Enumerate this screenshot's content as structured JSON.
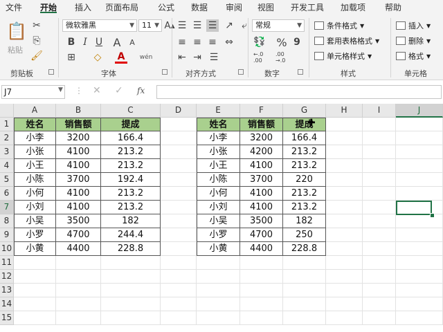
{
  "tabs": [
    "文件",
    "开始",
    "插入",
    "页面布局",
    "公式",
    "数据",
    "审阅",
    "视图",
    "开发工具",
    "加载项",
    "帮助"
  ],
  "active_tab": "开始",
  "ribbon": {
    "clipboard": {
      "paste": "粘贴",
      "label": "剪贴板"
    },
    "font": {
      "name": "微软雅黑",
      "size": "11",
      "label": "字体",
      "grow_glyph": "A",
      "shrink_glyph": "A",
      "bold": "B",
      "italic": "I",
      "underline": "U",
      "wen": "wén",
      "font_color_glyph": "A"
    },
    "alignment": {
      "label": "对齐方式"
    },
    "number": {
      "format": "常规",
      "label": "数字",
      "percent": "%",
      "comma": "9",
      "inc_decimal": "←.0 .00",
      "dec_decimal": ".00 →.0"
    },
    "styles": {
      "conditional": "条件格式",
      "table": "套用表格格式",
      "cell": "单元格样式",
      "label": "样式"
    },
    "cells": {
      "insert": "插入",
      "delete": "删除",
      "format": "格式",
      "label": "单元格"
    }
  },
  "formula_bar": {
    "name_box": "J7",
    "fx": "fx",
    "value": ""
  },
  "columns": [
    "A",
    "B",
    "C",
    "D",
    "E",
    "F",
    "G",
    "H",
    "I",
    "J"
  ],
  "selected_column": "J",
  "rows": [
    "1",
    "2",
    "3",
    "4",
    "5",
    "6",
    "7",
    "8",
    "9",
    "10",
    "11",
    "12",
    "13",
    "14",
    "15"
  ],
  "selected_row": "7",
  "table_left": {
    "headers": [
      "姓名",
      "销售额",
      "提成"
    ],
    "rows": [
      [
        "小李",
        "3200",
        "166.4"
      ],
      [
        "小张",
        "4100",
        "213.2"
      ],
      [
        "小王",
        "4100",
        "213.2"
      ],
      [
        "小陈",
        "3700",
        "192.4"
      ],
      [
        "小何",
        "4100",
        "213.2"
      ],
      [
        "小刘",
        "4100",
        "213.2"
      ],
      [
        "小吴",
        "3500",
        "182"
      ],
      [
        "小罗",
        "4700",
        "244.4"
      ],
      [
        "小黄",
        "4400",
        "228.8"
      ]
    ]
  },
  "table_right": {
    "headers": [
      "姓名",
      "销售额",
      "提成"
    ],
    "rows": [
      [
        "小李",
        "3200",
        "166.4"
      ],
      [
        "小张",
        "4200",
        "213.2"
      ],
      [
        "小王",
        "4100",
        "213.2"
      ],
      [
        "小陈",
        "3700",
        "220"
      ],
      [
        "小何",
        "4100",
        "213.2"
      ],
      [
        "小刘",
        "4100",
        "213.2"
      ],
      [
        "小吴",
        "3500",
        "182"
      ],
      [
        "小罗",
        "4700",
        "250"
      ],
      [
        "小黄",
        "4400",
        "228.8"
      ]
    ]
  },
  "colors": {
    "accent": "#217346",
    "header_fill": "#a9d08e"
  },
  "active_cell": "J7"
}
